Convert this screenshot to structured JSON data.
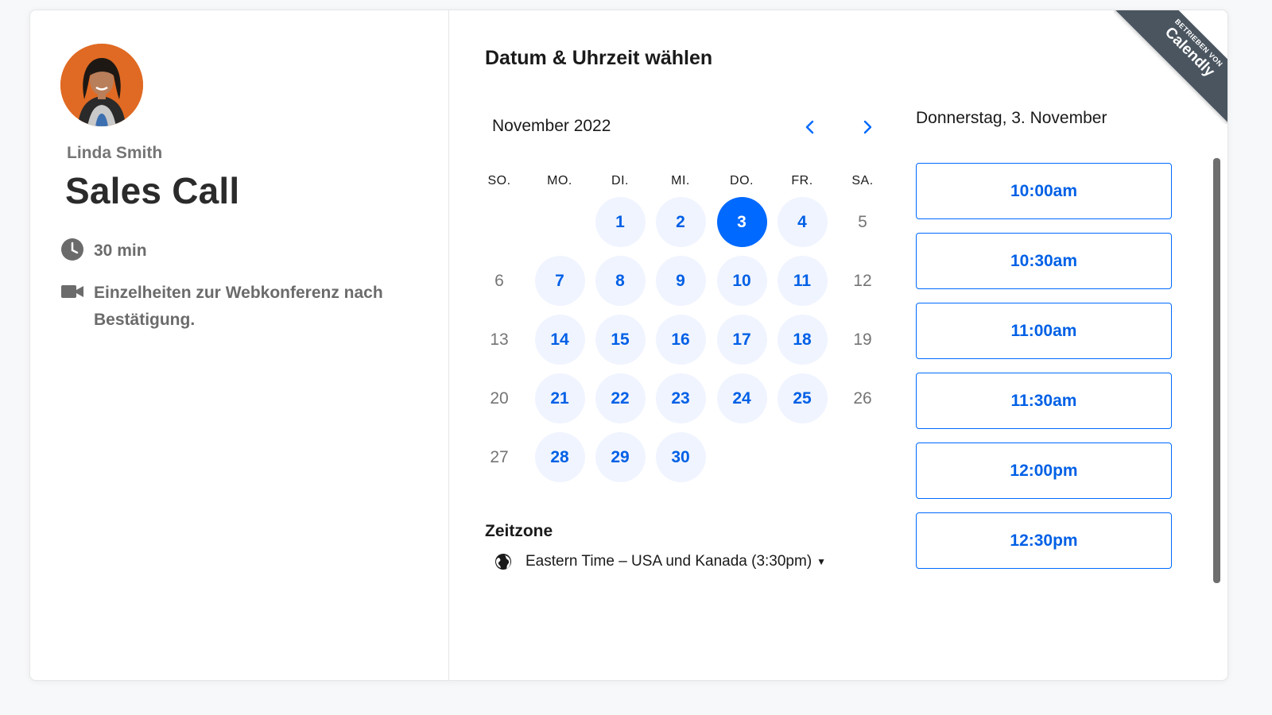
{
  "host": {
    "name": "Linda Smith",
    "event_title": "Sales Call",
    "duration": "30 min",
    "conference_info": "Einzelheiten zur Webkonferenz nach Bestätigung."
  },
  "picker": {
    "title": "Datum & Uhrzeit wählen",
    "month_label": "November 2022",
    "weekdays": [
      "SO.",
      "MO.",
      "DI.",
      "MI.",
      "DO.",
      "FR.",
      "SA."
    ],
    "weeks": [
      [
        null,
        null,
        {
          "d": "1",
          "s": "avail"
        },
        {
          "d": "2",
          "s": "avail"
        },
        {
          "d": "3",
          "s": "selected"
        },
        {
          "d": "4",
          "s": "avail"
        },
        {
          "d": "5",
          "s": "disabled"
        }
      ],
      [
        {
          "d": "6",
          "s": "disabled"
        },
        {
          "d": "7",
          "s": "avail"
        },
        {
          "d": "8",
          "s": "avail"
        },
        {
          "d": "9",
          "s": "avail"
        },
        {
          "d": "10",
          "s": "avail"
        },
        {
          "d": "11",
          "s": "avail"
        },
        {
          "d": "12",
          "s": "disabled"
        }
      ],
      [
        {
          "d": "13",
          "s": "disabled"
        },
        {
          "d": "14",
          "s": "avail"
        },
        {
          "d": "15",
          "s": "avail"
        },
        {
          "d": "16",
          "s": "avail"
        },
        {
          "d": "17",
          "s": "avail"
        },
        {
          "d": "18",
          "s": "avail"
        },
        {
          "d": "19",
          "s": "disabled"
        }
      ],
      [
        {
          "d": "20",
          "s": "disabled"
        },
        {
          "d": "21",
          "s": "avail"
        },
        {
          "d": "22",
          "s": "avail"
        },
        {
          "d": "23",
          "s": "avail"
        },
        {
          "d": "24",
          "s": "avail"
        },
        {
          "d": "25",
          "s": "avail"
        },
        {
          "d": "26",
          "s": "disabled"
        }
      ],
      [
        {
          "d": "27",
          "s": "disabled"
        },
        {
          "d": "28",
          "s": "avail"
        },
        {
          "d": "29",
          "s": "avail"
        },
        {
          "d": "30",
          "s": "avail"
        },
        null,
        null,
        null
      ]
    ],
    "timezone_label": "Zeitzone",
    "timezone_value": "Eastern Time – USA und Kanada (3:30pm)"
  },
  "times": {
    "selected_date": "Donnerstag, 3. November",
    "slots": [
      "10:00am",
      "10:30am",
      "11:00am",
      "11:30am",
      "12:00pm",
      "12:30pm"
    ]
  },
  "ribbon": {
    "small_text": "BETRIEBEN VON",
    "brand": "Calendly"
  },
  "colors": {
    "accent": "#0069ff",
    "available_bg": "#f0f4ff",
    "ribbon_bg": "#4a5560"
  },
  "icons": {
    "duration": "clock-icon",
    "conference": "video-camera-icon",
    "timezone": "globe-icon",
    "prev": "chevron-left-icon",
    "next": "chevron-right-icon",
    "timezone_dropdown": "caret-down-icon"
  }
}
